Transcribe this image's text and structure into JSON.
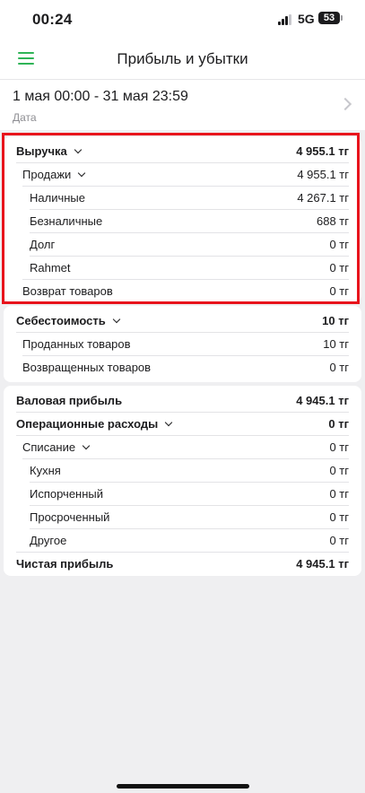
{
  "status": {
    "time": "00:24",
    "network": "5G",
    "battery": "53"
  },
  "header": {
    "title": "Прибыль и убытки"
  },
  "period": {
    "range": "1 мая 00:00 - 31 мая 23:59",
    "label": "Дата"
  },
  "revenue": {
    "title": "Выручка",
    "total": "4 955.1 тг",
    "sales": {
      "label": "Продажи",
      "value": "4 955.1 тг"
    },
    "cash": {
      "label": "Наличные",
      "value": "4 267.1 тг"
    },
    "noncash": {
      "label": "Безналичные",
      "value": "688 тг"
    },
    "debt": {
      "label": "Долг",
      "value": "0 тг"
    },
    "rahmet": {
      "label": "Rahmet",
      "value": "0 тг"
    },
    "returns": {
      "label": "Возврат товаров",
      "value": "0 тг"
    }
  },
  "cost": {
    "title": "Себестоимость",
    "total": "10 тг",
    "sold": {
      "label": "Проданных товаров",
      "value": "10 тг"
    },
    "returned": {
      "label": "Возвращенных товаров",
      "value": "0 тг"
    }
  },
  "profit": {
    "gross": {
      "label": "Валовая прибыль",
      "value": "4 945.1 тг"
    },
    "opex": {
      "label": "Операционные расходы",
      "value": "0 тг"
    },
    "writeoff": {
      "label": "Списание",
      "value": "0 тг"
    },
    "kitchen": {
      "label": "Кухня",
      "value": "0 тг"
    },
    "spoiled": {
      "label": "Испорченный",
      "value": "0 тг"
    },
    "expired": {
      "label": "Просроченный",
      "value": "0 тг"
    },
    "other": {
      "label": "Другое",
      "value": "0 тг"
    },
    "net": {
      "label": "Чистая прибыль",
      "value": "4 945.1 тг"
    }
  },
  "colors": {
    "accent": "#2fb457",
    "highlight": "#e8141c"
  }
}
